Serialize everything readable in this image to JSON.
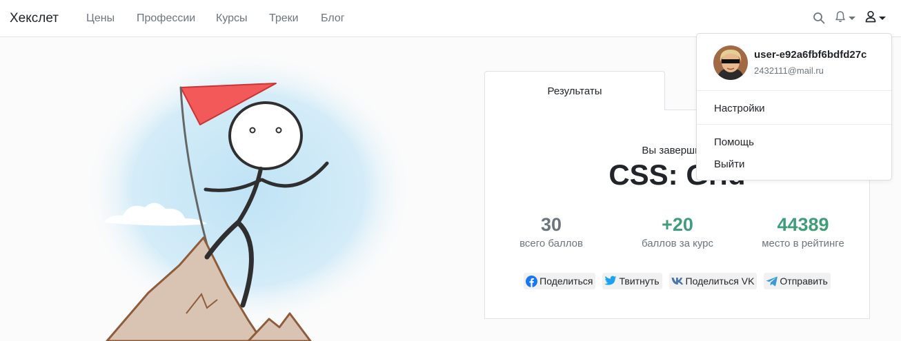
{
  "navbar": {
    "brand": "Хекслет",
    "links": [
      "Цены",
      "Профессии",
      "Курсы",
      "Треки",
      "Блог"
    ]
  },
  "icons": {
    "search": "search-icon",
    "notifications": "bell-icon",
    "user": "user-icon"
  },
  "results": {
    "tab": "Результаты",
    "completed_text": "Вы завершили",
    "course_title": "CSS: Grid",
    "stats": [
      {
        "value": "30",
        "label": "всего баллов",
        "color": "#6c757d"
      },
      {
        "value": "+20",
        "label": "баллов за курс",
        "color": "#3f9d7b"
      },
      {
        "value": "44389",
        "label": "место в рейтинге",
        "color": "#3f9d7b"
      }
    ],
    "share": {
      "facebook": "Поделиться",
      "twitter": "Твитнуть",
      "vk": "Поделиться VK",
      "telegram": "Отправить"
    }
  },
  "dropdown": {
    "username": "user-e92a6fbf6bdfd27c",
    "email": "2432111@mail.ru",
    "settings": "Настройки",
    "help": "Помощь",
    "logout": "Выйти"
  },
  "colors": {
    "accent_green": "#3f9d7b",
    "flag_red": "#f25a5a",
    "muted": "#6c757d"
  }
}
